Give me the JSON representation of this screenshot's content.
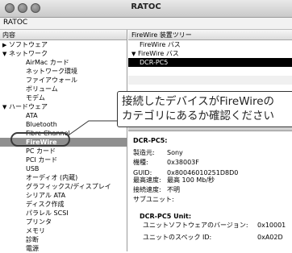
{
  "window": {
    "title": "RATOC",
    "host": "RATOC"
  },
  "sidebar": {
    "header": "内容",
    "items": [
      {
        "label": "ソフトウェア",
        "level": 0,
        "toggle": "▶"
      },
      {
        "label": "ネットワーク",
        "level": 0,
        "toggle": "▼"
      },
      {
        "label": "AirMac カード",
        "level": 1
      },
      {
        "label": "ネットワーク環境",
        "level": 1
      },
      {
        "label": "ファイアウォール",
        "level": 1
      },
      {
        "label": "ボリューム",
        "level": 1
      },
      {
        "label": "モデム",
        "level": 1
      },
      {
        "label": "ハードウェア",
        "level": 0,
        "toggle": "▼"
      },
      {
        "label": "ATA",
        "level": 1
      },
      {
        "label": "Bluetooth",
        "level": 1
      },
      {
        "label": "Fibre Channel",
        "level": 1
      },
      {
        "label": "FireWire",
        "level": 1,
        "selected": true
      },
      {
        "label": "PC カード",
        "level": 1
      },
      {
        "label": "PCI カード",
        "level": 1
      },
      {
        "label": "USB",
        "level": 1
      },
      {
        "label": "オーディオ (内蔵)",
        "level": 1
      },
      {
        "label": "グラフィックス/ディスプレイ",
        "level": 1
      },
      {
        "label": "シリアル ATA",
        "level": 1
      },
      {
        "label": "ディスク作成",
        "level": 1
      },
      {
        "label": "パラレル SCSI",
        "level": 1
      },
      {
        "label": "プリンタ",
        "level": 1
      },
      {
        "label": "メモリ",
        "level": 1
      },
      {
        "label": "診断",
        "level": 1
      },
      {
        "label": "電源",
        "level": 1
      }
    ]
  },
  "device_tree": {
    "header": "FireWire 装置ツリー",
    "rows": [
      {
        "label": "FireWire バス",
        "toggle": ""
      },
      {
        "label": "FireWire バス",
        "toggle": "▼"
      },
      {
        "label": "DCR-PC5",
        "selected": true
      }
    ]
  },
  "details": {
    "device_title": "DCR-PC5:",
    "fields": [
      {
        "key": "製造元:",
        "value": "Sony"
      },
      {
        "key": "機種:",
        "value": "0x38003F"
      },
      {
        "key": "GUID:",
        "value": "0x80046010251D8D0"
      },
      {
        "key": "最高速度:",
        "value": "最高 100 Mb/秒"
      },
      {
        "key": "接続速度:",
        "value": "不明"
      },
      {
        "key": "サブユニット:",
        "value": ""
      }
    ],
    "unit_title": "DCR-PC5 Unit:",
    "unit_fields": [
      {
        "key": "ユニットソフトウェアのバージョン:",
        "value": "0x10001"
      },
      {
        "key": "ユニットのスペック ID:",
        "value": "0xA02D"
      }
    ]
  },
  "callout": {
    "line1": "接続したデバイスがFireWireの",
    "line2": "カテゴリにあるか確認ください"
  }
}
